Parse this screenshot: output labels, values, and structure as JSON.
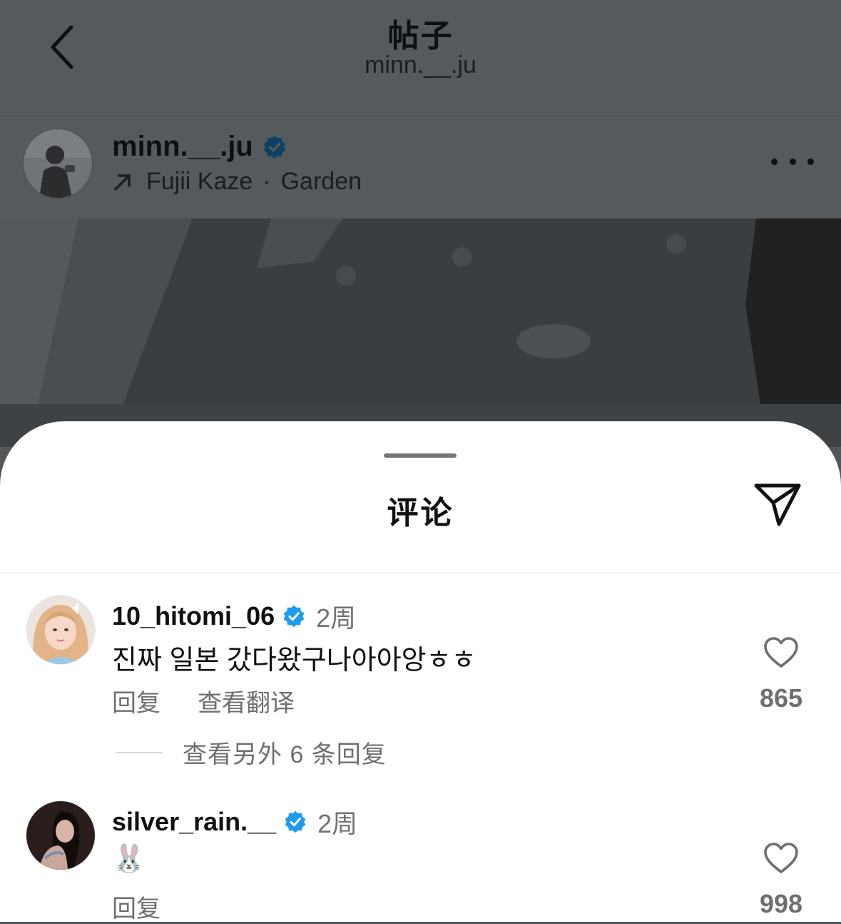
{
  "nav": {
    "title": "帖子",
    "subtitle": "minn.__.ju"
  },
  "post": {
    "username": "minn.__.ju",
    "verified": true,
    "music_artist": "Fujii Kaze",
    "music_separator": "·",
    "music_track": "Garden"
  },
  "sheet": {
    "title": "评论"
  },
  "comments": [
    {
      "username": "10_hitomi_06",
      "verified": true,
      "time": "2周",
      "text": "진짜 일본 갔다왔구나아아앙ㅎㅎ",
      "reply_label": "回复",
      "translate_label": "查看翻译",
      "likes": "865",
      "more_replies_label": "查看另外 6 条回复"
    },
    {
      "username": "silver_rain.__",
      "verified": true,
      "time": "2周",
      "text": "🐰",
      "reply_label": "回复",
      "likes": "998"
    }
  ],
  "colors": {
    "verified": "#1d9bf0",
    "dim_overlay": "#555a5e"
  }
}
